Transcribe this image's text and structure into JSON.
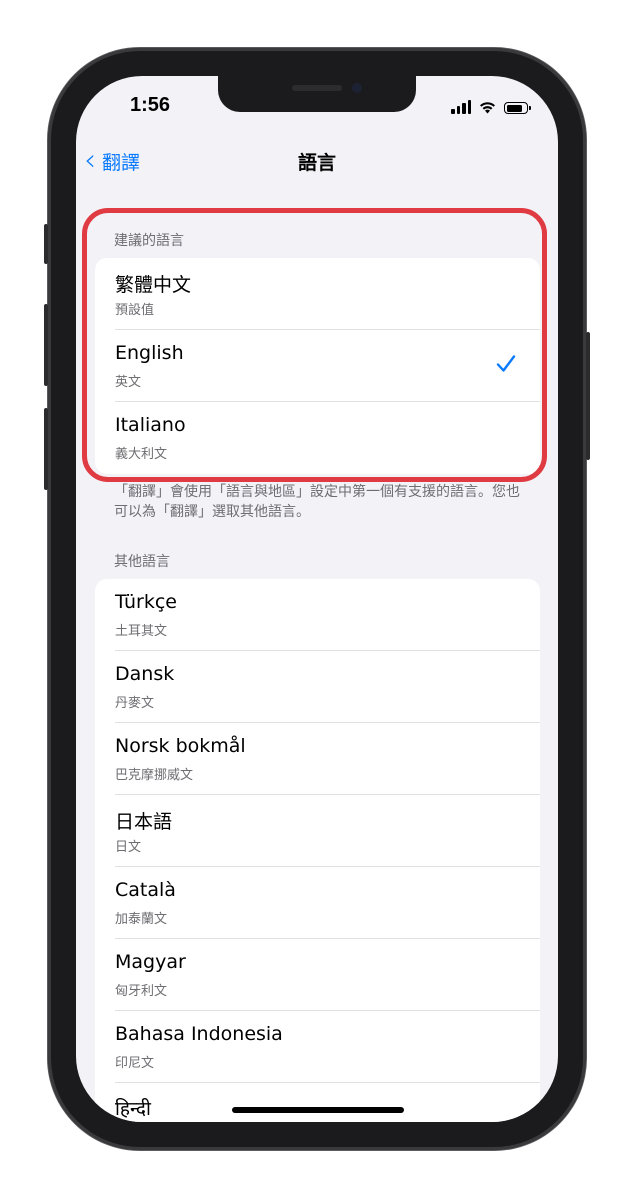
{
  "status_bar": {
    "time": "1:56"
  },
  "nav": {
    "back_label": "翻譯",
    "title": "語言"
  },
  "suggested": {
    "header": "建議的語言",
    "items": [
      {
        "title": "繁體中文",
        "subtitle": "預設值",
        "selected": false
      },
      {
        "title": "English",
        "subtitle": "英文",
        "selected": true
      },
      {
        "title": "Italiano",
        "subtitle": "義大利文",
        "selected": false
      }
    ],
    "footer": "「翻譯」會使用「語言與地區」設定中第一個有支援的語言。您也可以為「翻譯」選取其他語言。"
  },
  "other": {
    "header": "其他語言",
    "items": [
      {
        "title": "Türkçe",
        "subtitle": "土耳其文"
      },
      {
        "title": "Dansk",
        "subtitle": "丹麥文"
      },
      {
        "title": "Norsk bokmål",
        "subtitle": "巴克摩挪威文"
      },
      {
        "title": "日本語",
        "subtitle": "日文"
      },
      {
        "title": "Català",
        "subtitle": "加泰蘭文"
      },
      {
        "title": "Magyar",
        "subtitle": "匈牙利文"
      },
      {
        "title": "Bahasa Indonesia",
        "subtitle": "印尼文"
      },
      {
        "title": "हिन्दी",
        "subtitle": ""
      }
    ]
  },
  "colors": {
    "accent": "#0a7aff",
    "highlight": "#e03a42",
    "background": "#f2f2f7"
  }
}
